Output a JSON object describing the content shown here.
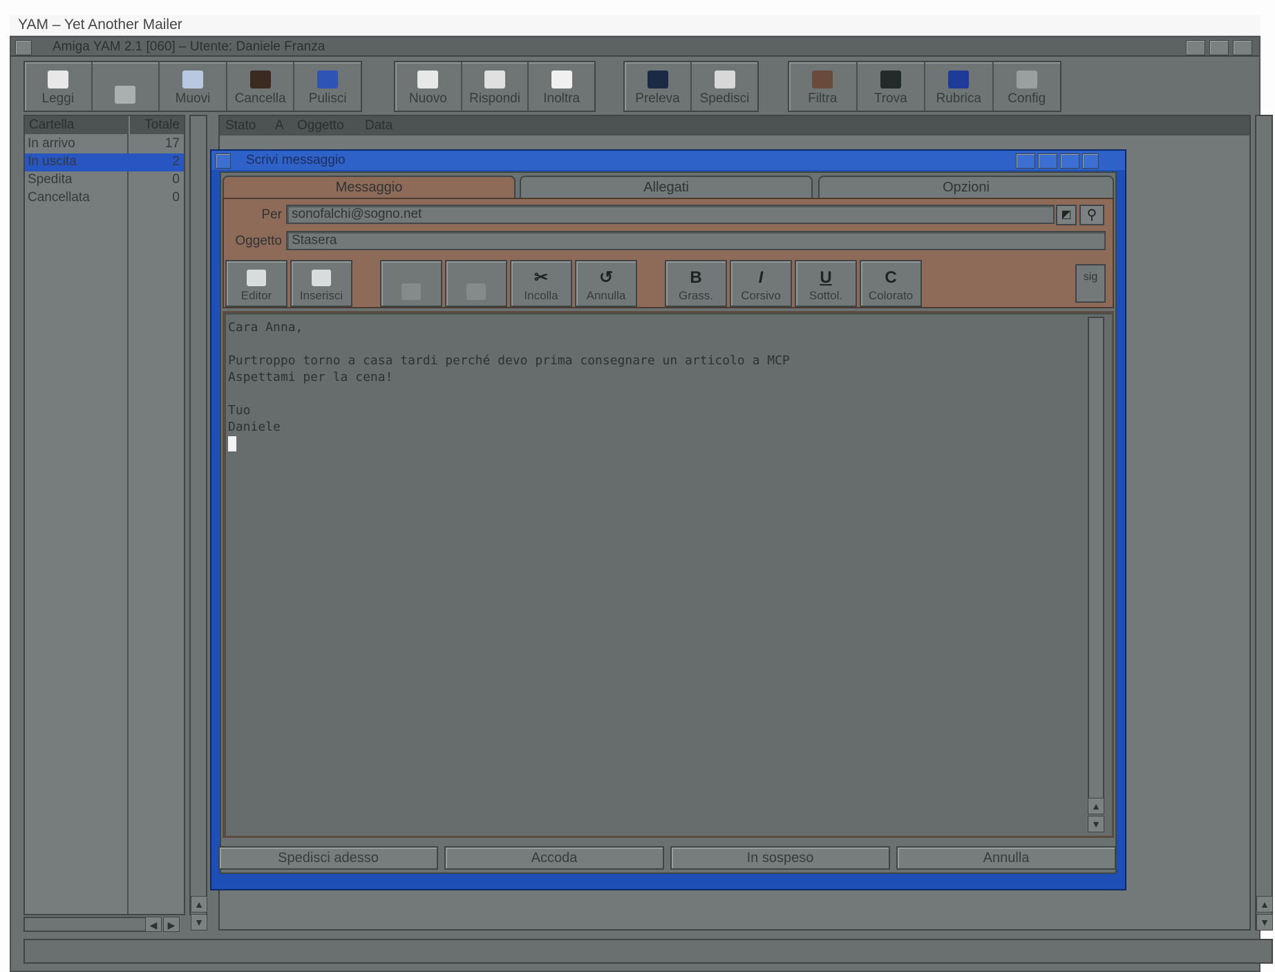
{
  "window": {
    "title": "YAM – Yet Another Mailer"
  },
  "screen": {
    "title": "Amiga YAM 2.1 [060]  –  Utente: Daniele Franza"
  },
  "toolbar": {
    "groups": [
      [
        {
          "label": "Leggi",
          "icon": "read-icon",
          "enabled": true
        },
        {
          "label": "",
          "icon": "edit-icon",
          "enabled": false
        },
        {
          "label": "Muovi",
          "icon": "move-icon",
          "enabled": true
        },
        {
          "label": "Cancella",
          "icon": "delete-icon",
          "enabled": true
        },
        {
          "label": "Pulisci",
          "icon": "clean-icon",
          "enabled": true
        }
      ],
      [
        {
          "label": "Nuovo",
          "icon": "new-icon",
          "enabled": true
        },
        {
          "label": "Rispondi",
          "icon": "reply-icon",
          "enabled": true
        },
        {
          "label": "Inoltra",
          "icon": "forward-icon",
          "enabled": true
        }
      ],
      [
        {
          "label": "Preleva",
          "icon": "fetch-icon",
          "enabled": true
        },
        {
          "label": "Spedisci",
          "icon": "send-icon",
          "enabled": true
        }
      ],
      [
        {
          "label": "Filtra",
          "icon": "filter-icon",
          "enabled": true
        },
        {
          "label": "Trova",
          "icon": "find-icon",
          "enabled": true
        },
        {
          "label": "Rubrica",
          "icon": "addressbook-icon",
          "enabled": true
        },
        {
          "label": "Config",
          "icon": "config-icon",
          "enabled": true
        }
      ]
    ]
  },
  "folders": {
    "col_name": "Cartella",
    "col_total": "Totale",
    "items": [
      {
        "name": "In arrivo",
        "total": "17",
        "selected": false
      },
      {
        "name": "In uscita",
        "total": "2",
        "selected": true
      },
      {
        "name": "Spedita",
        "total": "0",
        "selected": false
      },
      {
        "name": "Cancellata",
        "total": "0",
        "selected": false
      }
    ]
  },
  "message_list": {
    "columns": [
      "Stato",
      "A",
      "Oggetto",
      "Data"
    ]
  },
  "compose": {
    "title": "Scrivi messaggio",
    "tabs": [
      "Messaggio",
      "Allegati",
      "Opzioni"
    ],
    "to_label": "Per",
    "to_value": "sonofalchi@sogno.net",
    "subject_label": "Oggetto",
    "subject_value": "Stasera",
    "editor_buttons": [
      [
        {
          "label": "Editor",
          "icon": "editor-icon",
          "glyph": "",
          "enabled": true
        },
        {
          "label": "Inserisci",
          "icon": "insert-icon",
          "glyph": "",
          "enabled": true
        }
      ],
      [
        {
          "label": "",
          "icon": "cut-icon",
          "glyph": "",
          "enabled": false
        },
        {
          "label": "",
          "icon": "copy-icon",
          "glyph": "",
          "enabled": false
        },
        {
          "label": "Incolla",
          "icon": "paste-icon",
          "glyph": "✂",
          "enabled": true
        },
        {
          "label": "Annulla",
          "icon": "undo-icon",
          "glyph": "↺",
          "enabled": true
        }
      ],
      [
        {
          "label": "Grass.",
          "icon": "bold-icon",
          "glyph": "B",
          "enabled": true
        },
        {
          "label": "Corsivo",
          "icon": "italic-icon",
          "glyph": "I",
          "enabled": true
        },
        {
          "label": "Sottol.",
          "icon": "underline-icon",
          "glyph": "U",
          "enabled": true
        },
        {
          "label": "Colorato",
          "icon": "color-icon",
          "glyph": "C",
          "enabled": true
        }
      ]
    ],
    "side_badge": "sig",
    "body_lines": [
      "Cara Anna,",
      "",
      "Purtroppo torno a casa tardi perché devo prima consegnare un articolo a MCP",
      "Aspettami per la cena!",
      "",
      "Tuo",
      "Daniele"
    ],
    "bottom_buttons": [
      "Spedisci adesso",
      "Accoda",
      "In sospeso",
      "Annulla"
    ]
  },
  "colors": {
    "screen_bg": "#6b7070",
    "compose_frame": "#1d4fb6",
    "tab_panel": "#8e6a58",
    "selected_folder": "#2756c2"
  }
}
